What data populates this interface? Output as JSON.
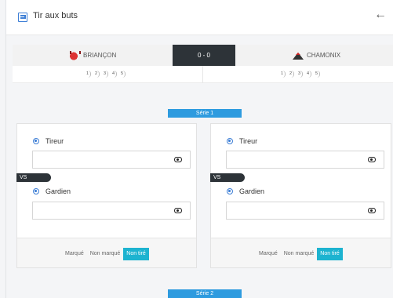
{
  "header": {
    "title": "Tir aux buts",
    "back_icon": "arrow-left-icon",
    "menu_icon": "list-icon"
  },
  "match": {
    "home_team": "BRIANÇON",
    "away_team": "CHAMONIX",
    "score": "0 - 0"
  },
  "shots": {
    "home": [
      "1",
      "2",
      "3",
      "4",
      "5"
    ],
    "away": [
      "1",
      "2",
      "3",
      "4",
      "5"
    ]
  },
  "series": [
    {
      "label": "Série 1",
      "cards": [
        {
          "shooter_label": "Tireur",
          "goalie_label": "Gardien",
          "vs_label": "VS",
          "options": [
            "Marqué",
            "Non marqué",
            "Non tiré"
          ],
          "selected": "Non tiré"
        },
        {
          "shooter_label": "Tireur",
          "goalie_label": "Gardien",
          "vs_label": "VS",
          "options": [
            "Marqué",
            "Non marqué",
            "Non tiré"
          ],
          "selected": "Non tiré"
        }
      ]
    },
    {
      "label": "Série 2"
    }
  ],
  "colors": {
    "accent_blue": "#2e9bdf",
    "active_option": "#1db3d0",
    "dark": "#2d3338"
  }
}
